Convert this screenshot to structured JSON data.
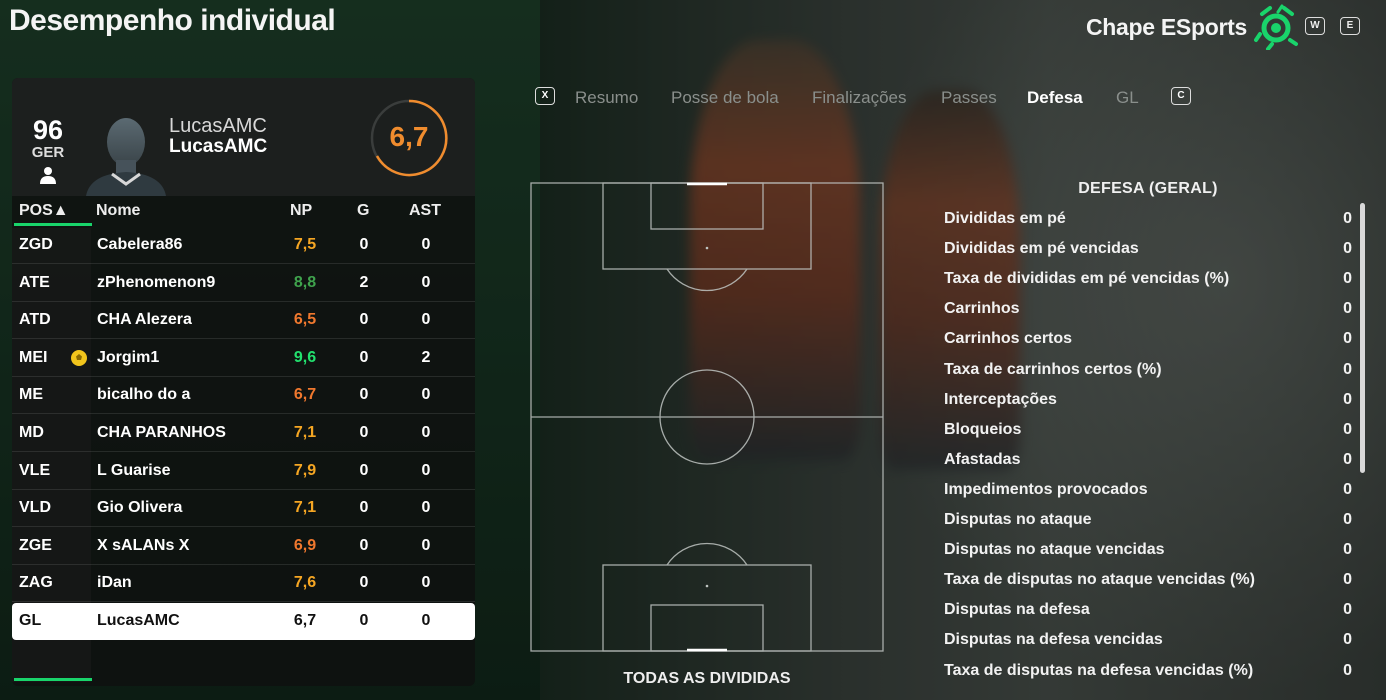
{
  "header": {
    "title": "Desempenho individual",
    "club": "Chape ESports",
    "key_w": "W",
    "key_e": "E"
  },
  "player": {
    "overall": "96",
    "overall_label": "GER",
    "name_line1": "LucasAMC",
    "name_line2": "LucasAMC",
    "rating": "6,7"
  },
  "table": {
    "headers": {
      "pos": "POS▲",
      "name": "Nome",
      "np": "NP",
      "g": "G",
      "ast": "AST"
    },
    "rows": [
      {
        "pos": "ZGD",
        "name": "Cabelera86",
        "np": "7,5",
        "g": "0",
        "ast": "0",
        "np_color": "#f5a623"
      },
      {
        "pos": "ATE",
        "name": "zPhenomenon9",
        "np": "8,8",
        "g": "2",
        "ast": "0",
        "np_color": "#3fa34d"
      },
      {
        "pos": "ATD",
        "name": "CHA Alezera",
        "np": "6,5",
        "g": "0",
        "ast": "0",
        "np_color": "#f0782e"
      },
      {
        "pos": "MEI",
        "name": "Jorgim1",
        "np": "9,6",
        "g": "0",
        "ast": "2",
        "np_color": "#22e06e",
        "mvp": true
      },
      {
        "pos": "ME",
        "name": "bicalho do a",
        "np": "6,7",
        "g": "0",
        "ast": "0",
        "np_color": "#f0782e"
      },
      {
        "pos": "MD",
        "name": "CHA PARANHOS",
        "np": "7,1",
        "g": "0",
        "ast": "0",
        "np_color": "#f5a623"
      },
      {
        "pos": "VLE",
        "name": "L Guarise",
        "np": "7,9",
        "g": "0",
        "ast": "0",
        "np_color": "#f5a623"
      },
      {
        "pos": "VLD",
        "name": "Gio Olivera",
        "np": "7,1",
        "g": "0",
        "ast": "0",
        "np_color": "#f5a623"
      },
      {
        "pos": "ZGE",
        "name": "X sALANs X",
        "np": "6,9",
        "g": "0",
        "ast": "0",
        "np_color": "#f0782e"
      },
      {
        "pos": "ZAG",
        "name": "iDan",
        "np": "7,6",
        "g": "0",
        "ast": "0",
        "np_color": "#f5a623"
      },
      {
        "pos": "GL",
        "name": "LucasAMC",
        "np": "6,7",
        "g": "0",
        "ast": "0",
        "np_color": "#111111",
        "selected": true
      }
    ]
  },
  "tabs": {
    "key_left": "X",
    "key_right": "C",
    "items": [
      "Resumo",
      "Posse de bola",
      "Finalizações",
      "Passes",
      "Defesa",
      "GL"
    ],
    "active": "Defesa"
  },
  "pitch": {
    "title": "TODAS AS DIVIDIDAS"
  },
  "stats": {
    "title": "DEFESA (GERAL)",
    "rows": [
      {
        "label": "Divididas em pé",
        "value": "0"
      },
      {
        "label": "Divididas em pé vencidas",
        "value": "0"
      },
      {
        "label": "Taxa de divididas em pé vencidas (%)",
        "value": "0"
      },
      {
        "label": "Carrinhos",
        "value": "0"
      },
      {
        "label": "Carrinhos certos",
        "value": "0"
      },
      {
        "label": "Taxa de carrinhos certos (%)",
        "value": "0"
      },
      {
        "label": "Interceptações",
        "value": "0"
      },
      {
        "label": "Bloqueios",
        "value": "0"
      },
      {
        "label": "Afastadas",
        "value": "0"
      },
      {
        "label": "Impedimentos provocados",
        "value": "0"
      },
      {
        "label": "Disputas no ataque",
        "value": "0"
      },
      {
        "label": "Disputas no ataque vencidas",
        "value": "0"
      },
      {
        "label": "Taxa de disputas no ataque vencidas (%)",
        "value": "0"
      },
      {
        "label": "Disputas na defesa",
        "value": "0"
      },
      {
        "label": "Disputas na defesa vencidas",
        "value": "0"
      },
      {
        "label": "Taxa de disputas na defesa vencidas (%)",
        "value": "0"
      }
    ]
  },
  "colors": {
    "accent": "#19d46b",
    "rating": "#f08c2e"
  }
}
